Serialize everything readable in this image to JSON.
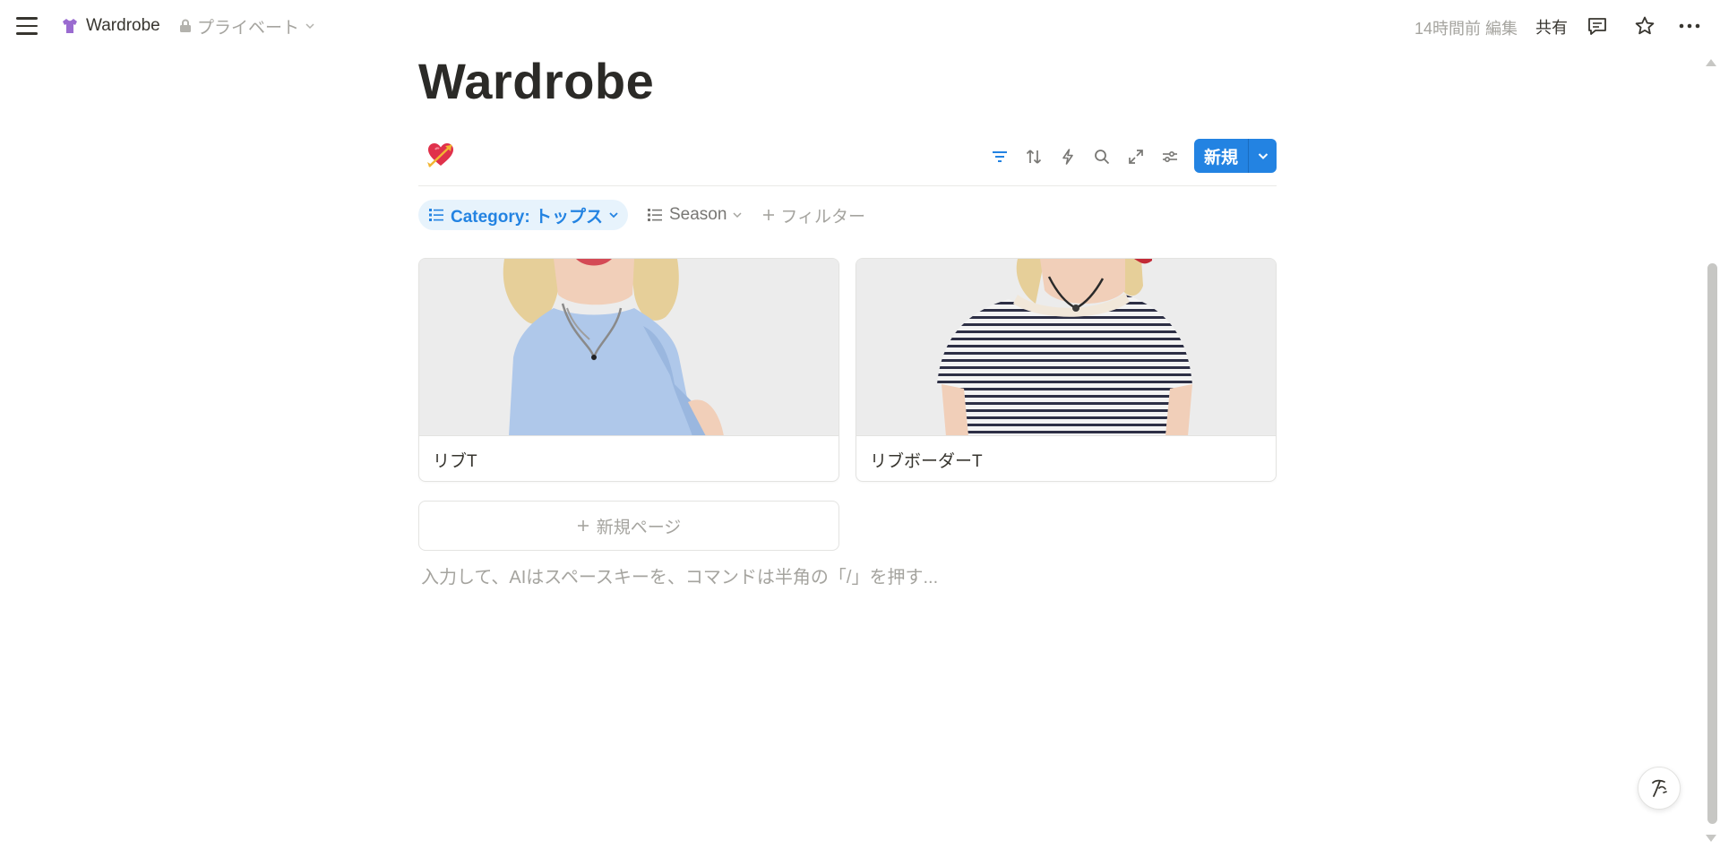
{
  "topbar": {
    "page_icon": "tshirt-icon",
    "title": "Wardrobe",
    "privacy": "プライベート",
    "edited": "14時間前 編集",
    "share": "共有"
  },
  "page": {
    "title": "Wardrobe"
  },
  "database": {
    "view_icon": "heart-with-arrow-icon",
    "tools": [
      "filter-icon",
      "sort-icon",
      "automation-icon",
      "search-icon",
      "expand-icon",
      "settings-icon"
    ],
    "new_button": "新規"
  },
  "filters": {
    "category_chip": "Category: トップス",
    "season_chip": "Season",
    "add_filter": "フィルター"
  },
  "cards": [
    {
      "title": "リブT",
      "image": "light-blue-ribbed-tshirt"
    },
    {
      "title": "リブボーダーT",
      "image": "striped-ribbed-tshirt"
    }
  ],
  "new_page": "新規ページ",
  "editor_placeholder": "入力して、AIはスペースキーを、コマンドは半角の「/」を押す...",
  "colors": {
    "accent": "#2383e2",
    "chip_bg": "#e7f3fc",
    "text": "#37352f",
    "muted": "#a5a49f"
  }
}
